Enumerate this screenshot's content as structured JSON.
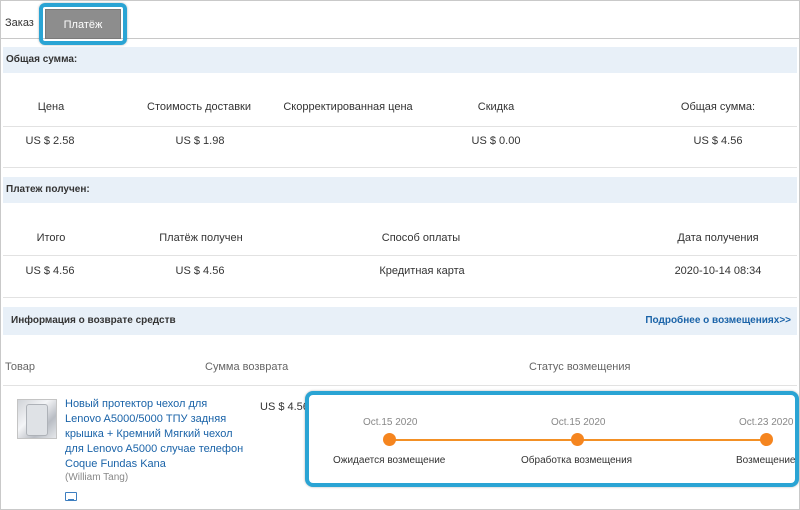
{
  "tabs": {
    "order": "Заказ",
    "payment": "Платёж"
  },
  "total_section": {
    "title": "Общая сумма:",
    "headers": [
      "Цена",
      "Стоимость доставки",
      "Скорректированная цена",
      "Скидка",
      "Общая сумма:"
    ],
    "values": [
      "US $ 2.58",
      "US $ 1.98",
      "",
      "US $ 0.00",
      "US $ 4.56"
    ]
  },
  "payment_section": {
    "title": "Платеж получен:",
    "headers": [
      "Итого",
      "Платёж получен",
      "Способ оплаты",
      "Дата получения"
    ],
    "values": [
      "US $ 4.56",
      "US $ 4.56",
      "Кредитная карта",
      "2020-10-14 08:34"
    ]
  },
  "refund_section": {
    "title": "Информация о возврате средств",
    "link": "Подробнее о возмещениях>>",
    "headers": [
      "Товар",
      "Сумма возврата",
      "Статус возмещения"
    ],
    "product": {
      "title": "Новый протектор чехол для Lenovo A5000/5000 ТПУ задняя крышка + Кремний Мягкий чехол для Lenovo A5000 случае телефон Coque Fundas Kana",
      "seller": "(William Tang)",
      "refund_amount": "US $ 4.56"
    },
    "progress": [
      {
        "date": "Oct.15 2020",
        "label": "Ожидается возмещение"
      },
      {
        "date": "Oct.15 2020",
        "label": "Обработка возмещения"
      },
      {
        "date": "Oct.23 2020",
        "label": "Возмещение"
      }
    ]
  },
  "colors": {
    "accent": "#2aa4d4",
    "progress": "#f5851f",
    "link": "#1a63a8",
    "section_bar": "#e8f0f8"
  }
}
